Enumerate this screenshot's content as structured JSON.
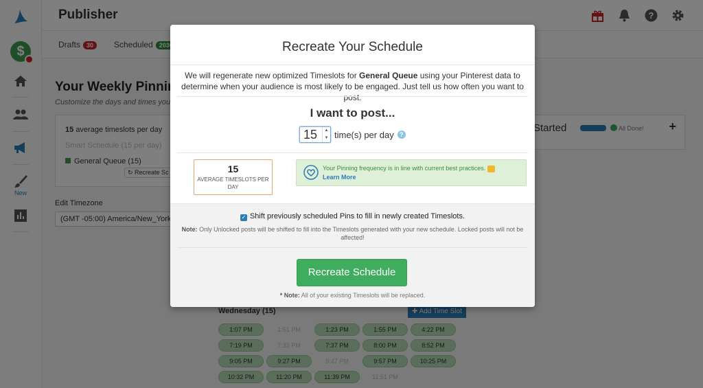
{
  "app": {
    "title": "Publisher"
  },
  "sidebar": {
    "new_label": "New"
  },
  "subnav": {
    "drafts": {
      "label": "Drafts",
      "count": "30",
      "color": "#c8232c"
    },
    "scheduled": {
      "label": "Scheduled",
      "count": "2030",
      "color": "#2f8a3c"
    }
  },
  "background": {
    "heading": "Your Weekly Pinnir",
    "subheading": "Customize the days and times you'c",
    "card": {
      "avg_count": "15",
      "avg_label": "average timeslots per day",
      "smart_schedule": "Smart Schedule (15 per day)",
      "queue": "General Queue (15)",
      "recreate_btn": "↻ Recreate Sc"
    },
    "timezone_label": "Edit Timezone",
    "timezone_value": "(GMT -05:00) America/New_York",
    "started": {
      "title": "Started",
      "status": "All Done!",
      "plus": "+"
    },
    "day": {
      "label": "Wednesday (15)",
      "add_btn": "✚ Add Time Slot"
    },
    "slots": [
      "1:07 PM",
      "1:51 PM",
      "1:23 PM",
      "1:55 PM",
      "4:22 PM",
      "7:19 PM",
      "7:33 PM",
      "7:37 PM",
      "8:00 PM",
      "8:52 PM",
      "9:05 PM",
      "9:27 PM",
      "9:47 PM",
      "9:57 PM",
      "10:25 PM",
      "10:32 PM",
      "11:20 PM",
      "11:39 PM",
      "11:51 PM",
      ""
    ]
  },
  "modal": {
    "title": "Recreate Your Schedule",
    "intro_pre": "We will regenerate new optimized Timeslots for ",
    "intro_queue": "General Queue",
    "intro_post": " using your Pinterest data to determine when your audience is most likely to be engaged. Just tell us how often you want to post.",
    "want_label": "I want to post...",
    "posts_per_day": "15",
    "unit_label": "time(s) per day",
    "help_icon": "?",
    "avg_value": "15",
    "avg_label": "AVERAGE TIMESLOTS PER DAY",
    "tip_message": "Your Pinning frequency is in line with current best practices.",
    "tip_link": "Learn More",
    "shift_label": "Shift previously scheduled Pins to fill in newly created Timeslots.",
    "note_label": "Note:",
    "note_text": " Only Unlocked posts will be shifted to fill into the Timeslots generated with your new schedule. Locked posts will not be affected!",
    "button_label": "Recreate Schedule",
    "footer_label": "* Note:",
    "footer_text": " All of your existing Timeslots will be replaced."
  },
  "colors": {
    "accent_green": "#3fad5f",
    "link_blue": "#2a7db7",
    "warning_orange": "#e8a56a"
  },
  "icons": [
    "logo-icon",
    "dollar-icon",
    "home-icon",
    "users-icon",
    "megaphone-icon",
    "brush-icon",
    "analytics-icon",
    "gift-icon",
    "bell-icon",
    "help-icon",
    "gear-icon",
    "heart-icon"
  ]
}
